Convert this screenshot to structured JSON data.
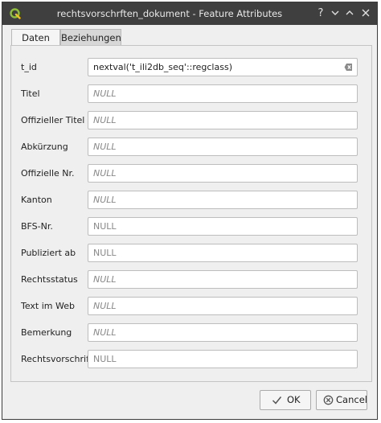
{
  "window": {
    "title": "rechtsvorschrften_dokument - Feature Attributes",
    "help_button": "?",
    "titlebar_bg": "#3f3f3f"
  },
  "tabs": [
    {
      "label": "Daten",
      "active": true
    },
    {
      "label": "Beziehungen",
      "active": false
    }
  ],
  "fields": [
    {
      "label": "t_id",
      "value": "nextval('t_ili2db_seq'::regclass)",
      "style": "value"
    },
    {
      "label": "Titel",
      "value": "NULL",
      "style": "null"
    },
    {
      "label": "Offizieller Titel",
      "value": "NULL",
      "style": "null"
    },
    {
      "label": "Abkürzung",
      "value": "NULL",
      "style": "null"
    },
    {
      "label": "Offizielle Nr.",
      "value": "NULL",
      "style": "null"
    },
    {
      "label": "Kanton",
      "value": "NULL",
      "style": "null"
    },
    {
      "label": "BFS-Nr.",
      "value": "NULL",
      "style": "plain"
    },
    {
      "label": "Publiziert ab",
      "value": "NULL",
      "style": "plain"
    },
    {
      "label": "Rechtsstatus",
      "value": "NULL",
      "style": "null"
    },
    {
      "label": "Text im Web",
      "value": "NULL",
      "style": "null"
    },
    {
      "label": "Bemerkung",
      "value": "NULL",
      "style": "null"
    },
    {
      "label": "Rechtsvorschrift",
      "value": "NULL",
      "style": "plain"
    }
  ],
  "buttons": {
    "ok_label": "OK",
    "cancel_label": "Cancel"
  },
  "icons": {
    "app": "qgis-logo-icon",
    "help": "help-icon",
    "minimize": "chevron-down-icon",
    "maximize": "chevron-up-icon",
    "close": "close-icon",
    "clear": "clear-field-icon",
    "ok": "checkmark-icon",
    "cancel": "cancel-circle-icon"
  },
  "colors": {
    "qgis_green": "#8fbe3a",
    "qgis_yellow": "#f0c020"
  }
}
